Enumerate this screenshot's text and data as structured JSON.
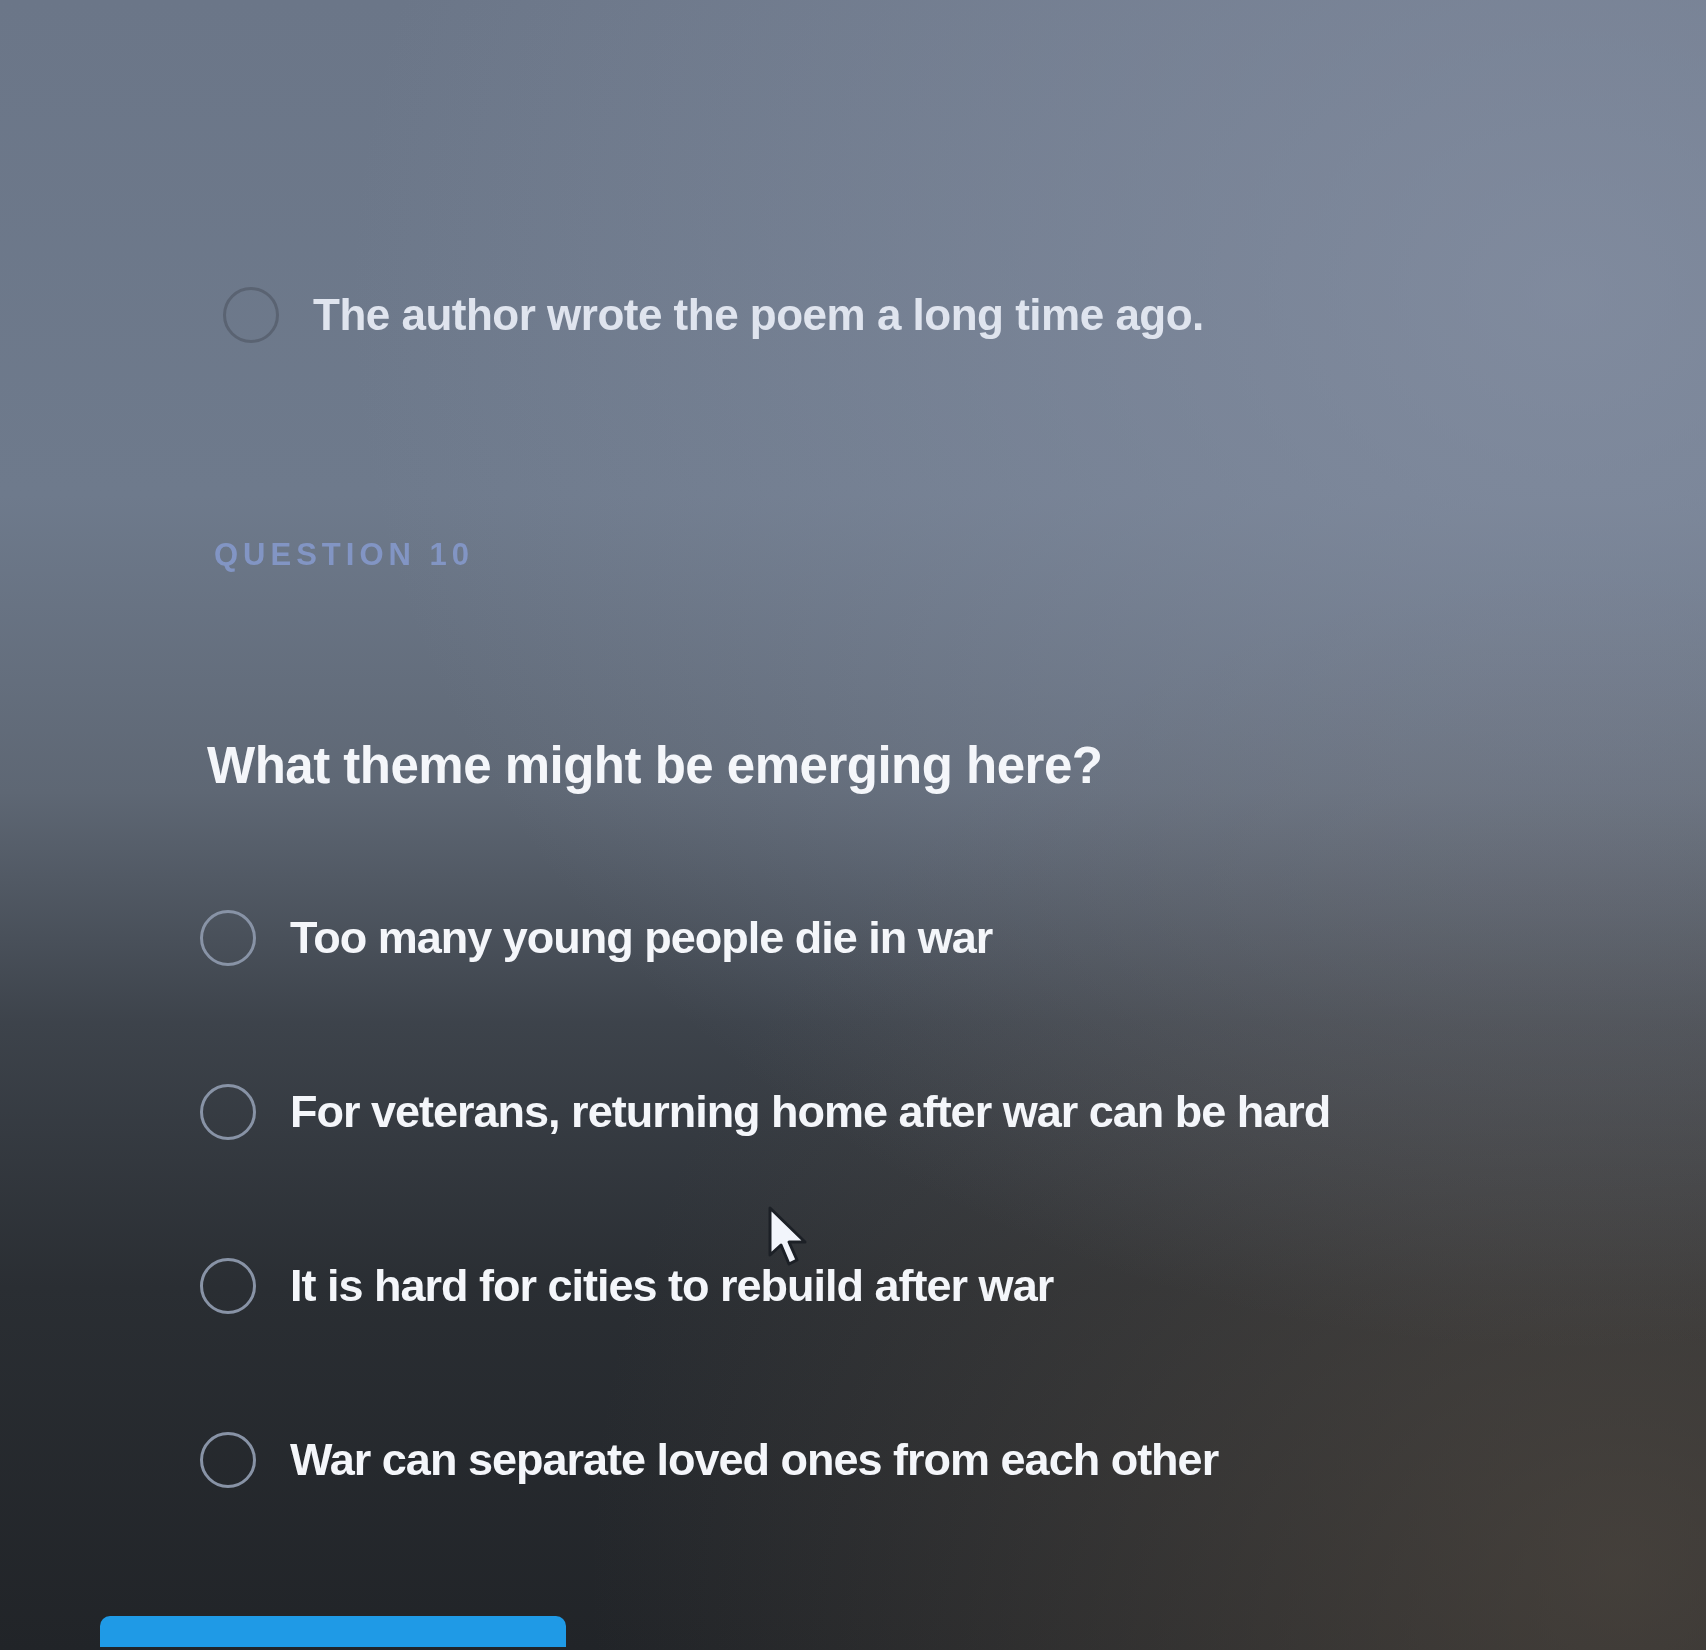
{
  "previous_question": {
    "options": [
      {
        "text": "The author wrote the poem a long time ago.",
        "selected": false
      }
    ]
  },
  "question": {
    "label": "QUESTION 10",
    "prompt": "What theme might be emerging here?",
    "options": [
      {
        "text": "Too many young people die in war",
        "selected": false
      },
      {
        "text": "For veterans, returning home after war can be hard",
        "selected": false
      },
      {
        "text": "It is hard for cities to rebuild after war",
        "selected": false
      },
      {
        "text": "War can separate loved ones from each other",
        "selected": false
      }
    ]
  }
}
